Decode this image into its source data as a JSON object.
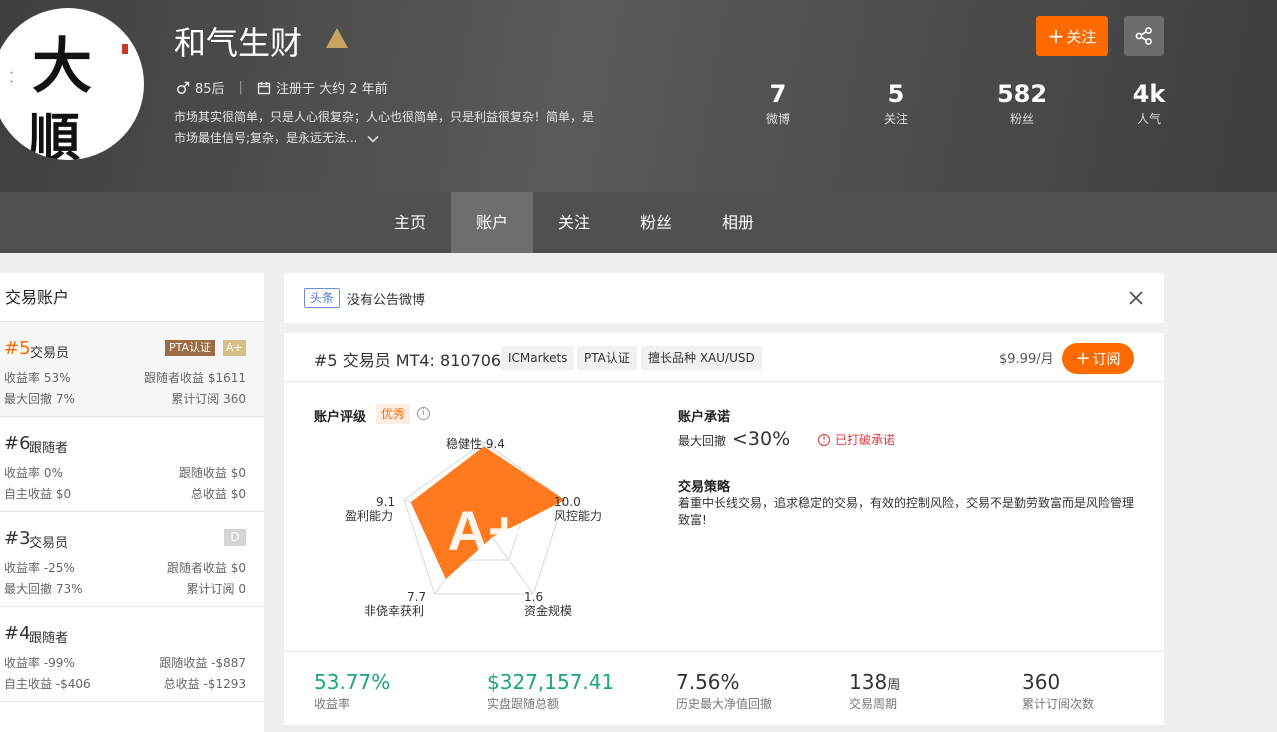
{
  "profile": {
    "name": "和气生财",
    "gender_icon": "male-icon",
    "age_group": "85后",
    "registered": "注册于 大约 2 年前",
    "bio_line1": "市场其实很简单，只是人心很复杂；人心也很简单，只是利益很复杂！简单，是",
    "bio_line2": "市场最佳信号;复杂，是永远无法...",
    "avatar_chars": [
      "大",
      "順"
    ],
    "stats": [
      {
        "value": "7",
        "label": "微博"
      },
      {
        "value": "5",
        "label": "关注"
      },
      {
        "value": "582",
        "label": "粉丝"
      },
      {
        "value": "4k",
        "label": "人气"
      }
    ],
    "follow_label": "关注"
  },
  "nav": {
    "tabs": [
      "主页",
      "账户",
      "关注",
      "粉丝",
      "相册"
    ],
    "active": "账户"
  },
  "sidebar": {
    "title": "交易账户",
    "accounts": [
      {
        "rank": "#5",
        "role": "交易员",
        "tags": [
          "PTA认证",
          "A+"
        ],
        "r1l": "收益率 53%",
        "r1r": "跟随者收益 $1611",
        "r2l": "最大回撤 7%",
        "r2r": "累计订阅 360"
      },
      {
        "rank": "#6",
        "role": "跟随者",
        "r1l": "收益率 0%",
        "r1r": "跟随收益 $0",
        "r2l": "自主收益 $0",
        "r2r": "总收益 $0"
      },
      {
        "rank": "#3",
        "role": "交易员",
        "tags": [
          "D"
        ],
        "r1l": "收益率 -25%",
        "r1r": "跟随者收益 $0",
        "r2l": "最大回撤 73%",
        "r2r": "累计订阅 0"
      },
      {
        "rank": "#4",
        "role": "跟随者",
        "r1l": "收益率 -99%",
        "r1r": "跟随收益 -$887",
        "r2l": "自主收益 -$406",
        "r2r": "总收益 -$1293"
      }
    ]
  },
  "announcement": {
    "tag": "头条",
    "text": "没有公告微博"
  },
  "account": {
    "rank": "#5",
    "role": "交易员",
    "platform": "MT4: 810706",
    "broker": "ICMarkets",
    "cert": "PTA认证",
    "specialty": "擅长品种 XAU/USD",
    "price": "$9.99/月",
    "subscribe_label": "订阅",
    "rating_title": "账户评级",
    "rating_badge": "优秀",
    "grade": "A+",
    "radar": [
      {
        "name": "稳健性",
        "value": 9.4
      },
      {
        "name": "风控能力",
        "value": 10.0
      },
      {
        "name": "资金规模",
        "value": 1.6
      },
      {
        "name": "非侥幸获利",
        "value": 7.7
      },
      {
        "name": "盈利能力",
        "value": 9.1
      }
    ],
    "radar_labels": {
      "top": "稳健性 9.4",
      "right_v": "10.0",
      "right_n": "风控能力",
      "br_v": "1.6",
      "br_n": "资金规模",
      "bl_v": "7.7",
      "bl_n": "非侥幸获利",
      "left_v": "9.1",
      "left_n": "盈利能力"
    },
    "promise_title": "账户承诺",
    "promise_label": "最大回撤",
    "promise_value": "<30%",
    "promise_status": "已打破承诺",
    "strategy_title": "交易策略",
    "strategy_text": "着重中长线交易，追求稳定的交易，有效的控制风险，交易不是勤劳致富而是风险管理致富!",
    "bottom_stats": [
      {
        "value": "53.77%",
        "label": "收益率"
      },
      {
        "value": "$327,157.41",
        "label": "实盘跟随总额"
      },
      {
        "value": "7.56%",
        "label": "历史最大净值回撤"
      },
      {
        "value": "138",
        "unit": "周",
        "label": "交易周期"
      },
      {
        "value": "360",
        "label": "累计订阅次数"
      }
    ]
  },
  "colors": {
    "accent": "#ff6a00",
    "green": "#1aa67c",
    "radar_fill": "#ff7a1f",
    "header_bg": "#505050"
  }
}
